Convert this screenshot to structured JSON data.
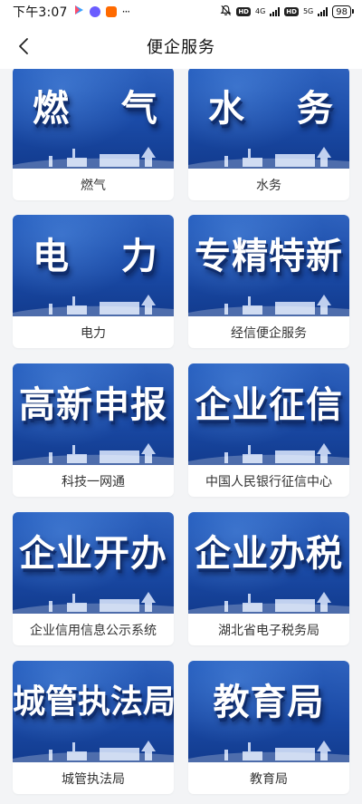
{
  "status_bar": {
    "time": "下午3:07",
    "network_4g": "4G",
    "network_5g": "5G",
    "hd": "HD",
    "battery": "98",
    "more": "···"
  },
  "header": {
    "title": "便企服务"
  },
  "cards": [
    {
      "banner": "燃  气",
      "label": "燃气"
    },
    {
      "banner": "水  务",
      "label": "水务"
    },
    {
      "banner": "电  力",
      "label": "电力"
    },
    {
      "banner": "专精特新",
      "label": "经信便企服务"
    },
    {
      "banner": "高新申报",
      "label": "科技一网通"
    },
    {
      "banner": "企业征信",
      "label": "中国人民银行征信中心"
    },
    {
      "banner": "企业开办",
      "label": "企业信用信息公示系统"
    },
    {
      "banner": "企业办税",
      "label": "湖北省电子税务局"
    },
    {
      "banner": "城管执法局",
      "label": "城管执法局"
    },
    {
      "banner": "教育局",
      "label": "教育局"
    }
  ],
  "colors": {
    "banner_blue": "#1d55b8",
    "page_bg": "#f3f4f6"
  }
}
